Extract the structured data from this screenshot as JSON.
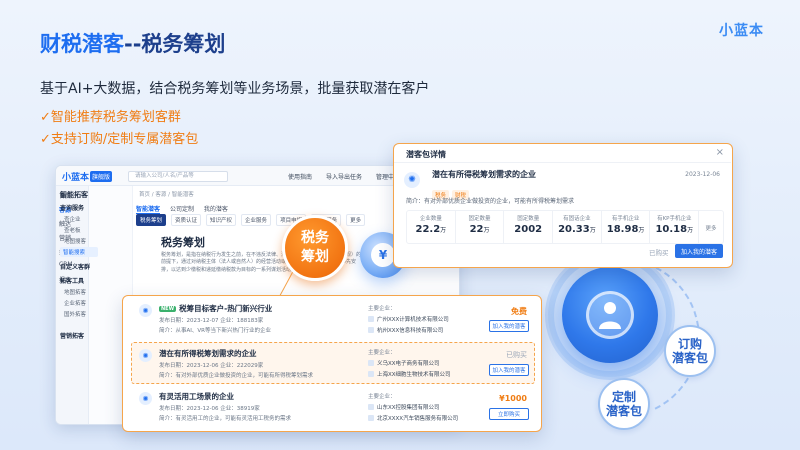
{
  "header": {
    "title_main": "财税潜客",
    "title_rest": "--税务筹划",
    "brand": "小蓝本",
    "subtitle": "基于AI+大数据，结合税务筹划等业务场景，批量获取潜在客户",
    "bullets": [
      "✓智能推荐税务筹划客群",
      "✓支持订购/定制专属潜客包"
    ]
  },
  "deco": {
    "order_bubble": "订购\n潜客包",
    "custom_bubble": "定制\n潜客包"
  },
  "app": {
    "logo": "小蓝本",
    "badge": "旗舰版",
    "search_placeholder": "请输入公司/人名/产品等",
    "topnav": [
      "使用指南",
      "导入导出任务",
      "管理中心"
    ],
    "sidebar": [
      "首页",
      "客源",
      "触达",
      "营销",
      "搜客",
      "CRM",
      "报表"
    ],
    "subnav_head": "智能拓客",
    "subnav_group1": "查询服务",
    "subnav_items": [
      "查企业",
      "查老板",
      "地图搜客",
      "智能搜索"
    ],
    "subnav_group2": "自定义客群",
    "subnav_group3": "拓客工具",
    "subnav_items2": [
      "地图拓客",
      "企业拓客",
      "国外拓客"
    ],
    "subnav_group4": "营销拓客",
    "crumb": "首页 / 客源 / 智能潜客",
    "tabs": [
      "智能潜客",
      "公司定制",
      "我的潜客"
    ],
    "categories": [
      "税务筹划",
      "资质认证",
      "知识产权",
      "企业服务",
      "项目申报",
      "工程服务",
      "更多"
    ],
    "detail_title": "税务筹划",
    "detail_text": "税务筹划，是指在纳税行为发生之前，在不违反法律、法规（税法及其他相关法律法规）的前提下，通过对纳税主体（法人或自然人）的经营活动或投资行为等涉税事项做出事先安排，以达到少缴税和递延缴纳税款为目标的一系列谋划活动。",
    "tax_badge": "税务\n筹划",
    "coin": "¥"
  },
  "package": {
    "head": "潜客包详情",
    "name": "潜在有所得税筹划需求的企业",
    "date": "2023-12-06",
    "tags": [
      "税务",
      "财税"
    ],
    "intro_label": "简介：",
    "intro": "有对外部优质企业做投资的企业，可能有所得税筹划需求",
    "stats": [
      {
        "label": "企业数量",
        "value": "22.2",
        "unit": "万"
      },
      {
        "label": "固定数量",
        "value": "22",
        "unit": "万"
      },
      {
        "label": "固定数量",
        "value": "2002",
        "unit": ""
      },
      {
        "label": "有固话企业",
        "value": "20.33",
        "unit": "万"
      },
      {
        "label": "有手机企业",
        "value": "18.98",
        "unit": "万"
      },
      {
        "label": "有KP手机企业",
        "value": "10.18",
        "unit": "万"
      }
    ],
    "more": "更多",
    "bought": "已购买",
    "add_button": "加入我的潜客"
  },
  "list": {
    "rows": [
      {
        "new_tag": "NEW",
        "title": "税筹目标客户-热门新兴行业",
        "meta": "发布日期：2023-12-07    企业：188183家",
        "desc": "简介：从事AI、VR等当下新兴热门行业的企业",
        "ent_label": "主要企业：",
        "ents": [
          "广州XXX计算机技术有限公司",
          "杭州XXX信息科技有限公司"
        ],
        "price": "免费",
        "button": "加入我的潜客"
      },
      {
        "new_tag": "",
        "title": "潜在有所得税筹划需求的企业",
        "meta": "发布日期：2023-12-06    企业：222029家",
        "desc": "简介：有对外部优质企业做投资的企业，可能有所得税筹划需求",
        "ent_label": "主要企业：",
        "ents": [
          "义乌XX电子商务有限公司",
          "上海XX细胞生物技术有限公司"
        ],
        "price": "已购买",
        "button": "加入我的潜客"
      },
      {
        "new_tag": "",
        "title": "有灵活用工场景的企业",
        "meta": "发布日期：2023-12-06    企业：38919家",
        "desc": "简介：有灵活用工的企业，可能有灵活用工税务的需求",
        "ent_label": "主要企业：",
        "ents": [
          "山东XX控股集团有限公司",
          "北京XXXX汽车销售服务有限公司"
        ],
        "price": "¥1000",
        "button": "立即购买"
      }
    ]
  },
  "colors": {
    "accent": "#1d6df0",
    "orange": "#f07d14",
    "title_dark": "#1d3f8c"
  }
}
